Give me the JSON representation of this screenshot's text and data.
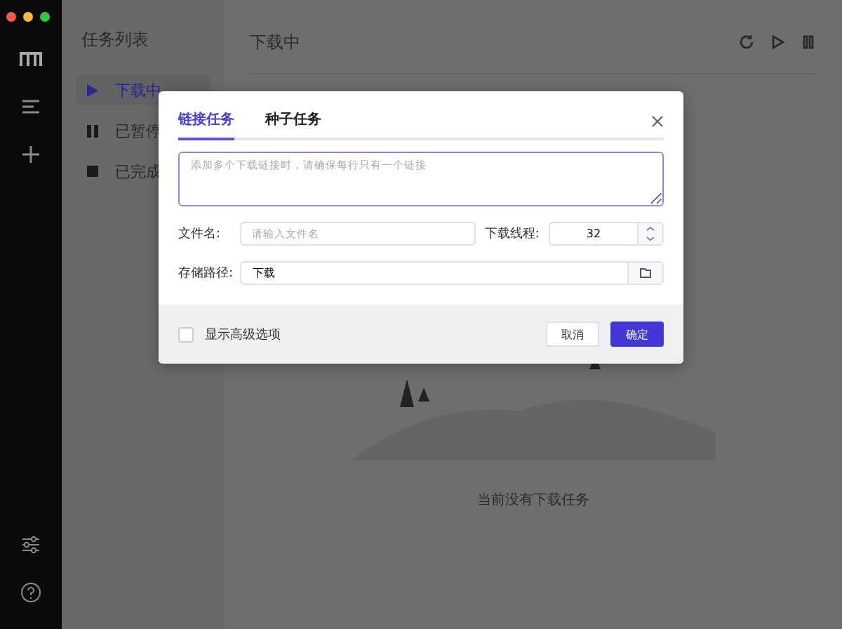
{
  "task_list": {
    "title": "任务列表",
    "items": [
      {
        "label": "下载中",
        "kind": "active",
        "selected": true
      },
      {
        "label": "已暂停",
        "kind": "paused",
        "selected": false
      },
      {
        "label": "已完成",
        "kind": "done",
        "selected": false
      }
    ]
  },
  "main": {
    "title": "下载中",
    "empty_text": "当前没有下载任务"
  },
  "dialog": {
    "tabs": [
      {
        "label": "链接任务",
        "selected": true
      },
      {
        "label": "种子任务",
        "selected": false
      }
    ],
    "url_field": {
      "placeholder": "添加多个下载链接时，请确保每行只有一个链接"
    },
    "filename": {
      "label": "文件名:",
      "placeholder": "请输入文件名"
    },
    "threads": {
      "label": "下载线程:",
      "value": "32"
    },
    "path": {
      "label": "存储路径:",
      "value": "下载"
    },
    "advanced": {
      "label": "显示高级选项",
      "checked": false
    },
    "buttons": [
      {
        "label": "取消",
        "kind": "secondary"
      },
      {
        "label": "确定",
        "kind": "primary"
      }
    ]
  }
}
